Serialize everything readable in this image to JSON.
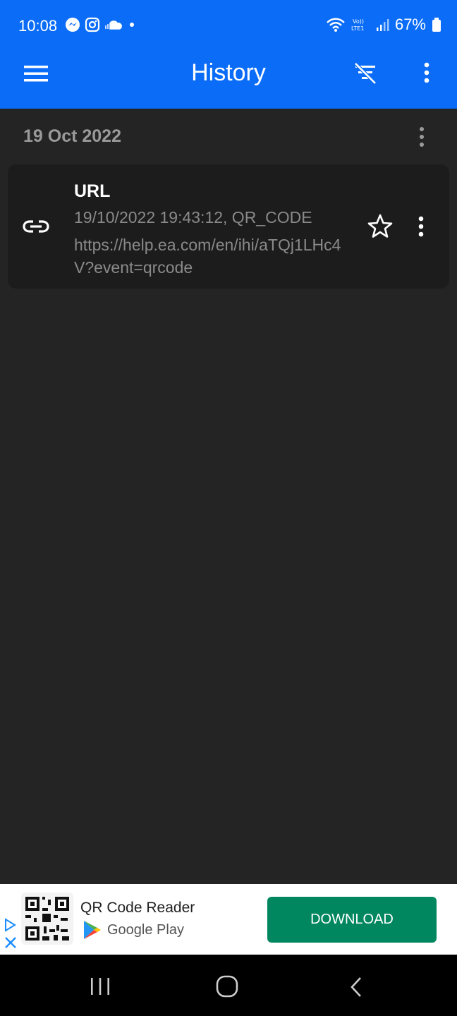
{
  "status_bar": {
    "time": "10:08",
    "battery": "67%",
    "left_icons": [
      "messenger-icon",
      "instagram-icon",
      "cloud-icon",
      "dot-icon"
    ],
    "right_icons": [
      "wifi-icon",
      "volte-icon",
      "signal-icon",
      "battery-icon"
    ]
  },
  "toolbar": {
    "title": "History",
    "icons": [
      "menu-icon",
      "clear-filter-icon",
      "more-vert-icon"
    ]
  },
  "history": {
    "date": "19 Oct 2022",
    "items": [
      {
        "type": "URL",
        "meta": "19/10/2022 19:43:12, QR_CODE",
        "content": "https://help.ea.com/en/ihi/aTQj1LHc4V?event=qrcode",
        "icon": "link-icon",
        "favorite": false
      }
    ]
  },
  "ad": {
    "title": "QR Code Reader",
    "store": "Google Play",
    "cta": "DOWNLOAD",
    "cta_color": "#01875f"
  },
  "colors": {
    "app_bar": "#0a6cf7",
    "background": "#242424",
    "card": "#1c1c1c"
  }
}
